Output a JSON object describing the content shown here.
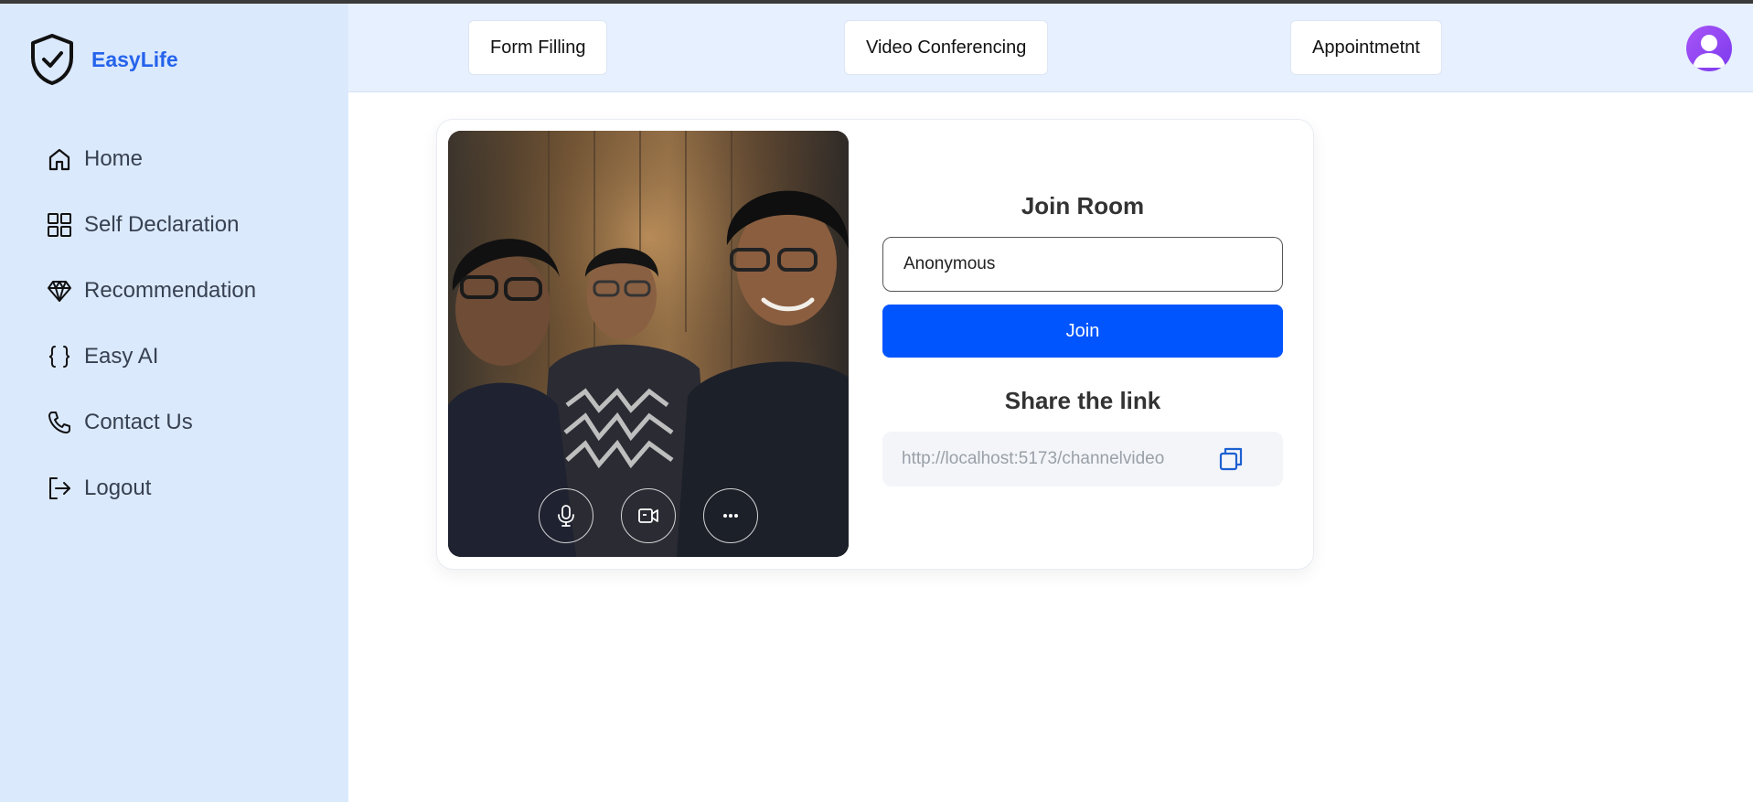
{
  "brand": {
    "name": "EasyLife",
    "icon": "shield-check-icon"
  },
  "sidebar": {
    "items": [
      {
        "label": "Home",
        "icon": "home-icon"
      },
      {
        "label": "Self Declaration",
        "icon": "grid-icon"
      },
      {
        "label": "Recommendation",
        "icon": "diamond-icon"
      },
      {
        "label": "Easy AI",
        "icon": "braces-icon"
      },
      {
        "label": "Contact Us",
        "icon": "phone-icon"
      },
      {
        "label": "Logout",
        "icon": "logout-icon"
      }
    ]
  },
  "header": {
    "tabs": [
      {
        "label": "Form Filling"
      },
      {
        "label": "Video Conferencing"
      },
      {
        "label": "Appointmetnt"
      }
    ],
    "avatar_icon": "user-avatar-icon"
  },
  "room": {
    "join_title": "Join Room",
    "name_value": "Anonymous",
    "join_label": "Join",
    "share_title": "Share the link",
    "link_text": "http://localhost:5173/channelvideo",
    "copy_icon": "copy-icon"
  },
  "video_controls": [
    {
      "icon": "microphone-icon"
    },
    {
      "icon": "video-camera-icon"
    },
    {
      "icon": "more-icon"
    }
  ],
  "colors": {
    "sidebar_bg": "#dbe9fd",
    "header_bg": "#e6f0fe",
    "brand": "#2563eb",
    "primary_button": "#0055ff"
  }
}
